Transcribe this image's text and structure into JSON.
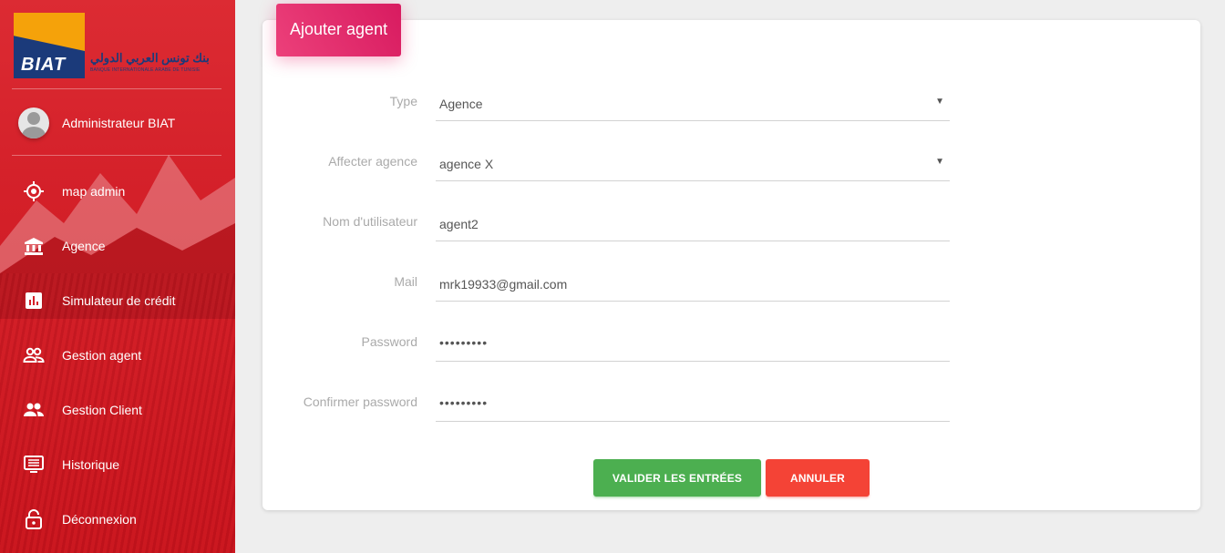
{
  "brand": {
    "logo_text": "BIAT",
    "arabic_text": "بنك تونس العربي الدولي",
    "subtitle": "BANQUE INTERNATIONALE ARABE DE TUNISIE",
    "primary_color": "#d42029",
    "logo_blue": "#1b3a7a",
    "logo_orange": "#f5a20a"
  },
  "user": {
    "name": "Administrateur BIAT"
  },
  "sidebar": {
    "items": [
      {
        "label": "map admin",
        "icon": "target-icon"
      },
      {
        "label": "Agence",
        "icon": "bank-icon"
      },
      {
        "label": "Simulateur de crédit",
        "icon": "chart-icon"
      },
      {
        "label": "Gestion agent",
        "icon": "people-outline-icon"
      },
      {
        "label": "Gestion Client",
        "icon": "people-icon"
      },
      {
        "label": "Historique",
        "icon": "monitor-icon"
      },
      {
        "label": "Déconnexion",
        "icon": "lock-icon"
      }
    ]
  },
  "form": {
    "title": "Ajouter agent",
    "accent": "#e91e63",
    "fields": [
      {
        "label": "Type",
        "value": "Agence",
        "kind": "select"
      },
      {
        "label": "Affecter agence",
        "value": "agence X",
        "kind": "select"
      },
      {
        "label": "Nom d'utilisateur",
        "value": "agent2",
        "kind": "text"
      },
      {
        "label": "Mail",
        "value": "mrk19933@gmail.com",
        "kind": "text"
      },
      {
        "label": "Password",
        "value": "•••••••••",
        "kind": "password"
      },
      {
        "label": "Confirmer password",
        "value": "•••••••••",
        "kind": "password"
      }
    ],
    "submit_label": "VALIDER LES ENTRÉES",
    "cancel_label": "ANNULER",
    "submit_color": "#4caf50",
    "cancel_color": "#f44336"
  }
}
